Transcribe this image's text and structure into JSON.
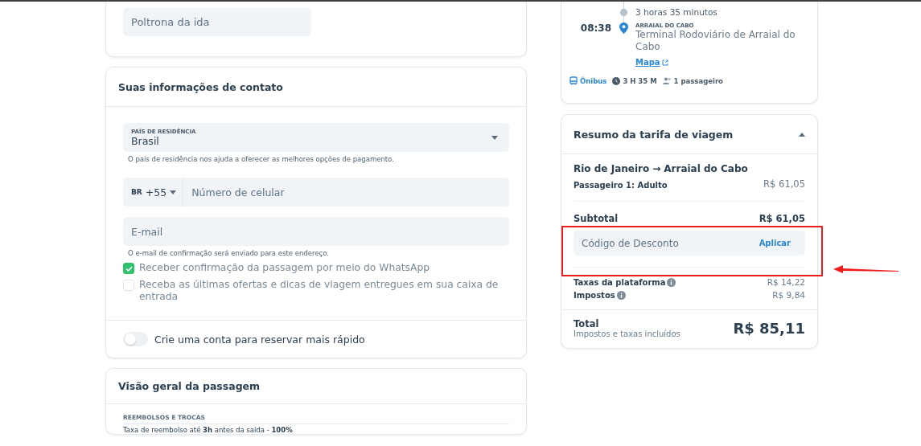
{
  "seat_card": {
    "seat_field": {
      "placeholder": "Poltrona da ida"
    }
  },
  "contact": {
    "title": "Suas informações de contato",
    "country": {
      "label": "PAÍS DE RESIDÊNCIA",
      "value": "Brasil",
      "hint": "O país de residência nos ajuda a oferecer as melhores opções de pagamento."
    },
    "phone": {
      "country_code": "BR",
      "dial": "+55",
      "placeholder": "Número de celular"
    },
    "email": {
      "placeholder": "E-mail",
      "hint": "O e-mail de confirmação será enviado para este endereço."
    },
    "checkboxes": [
      {
        "label": "Receber confirmação da passagem por meio do WhatsApp",
        "checked": true
      },
      {
        "label": "Receba as últimas ofertas e dicas de viagem entregues em sua caixa de entrada",
        "checked": false
      }
    ],
    "account_toggle": {
      "label": "Crie uma conta para reservar mais rápido",
      "on": false
    }
  },
  "overview": {
    "title": "Visão geral da passagem",
    "section": "REEMBOLSOS E TROCAS",
    "line": "Taxa de reembolso até **3h** antes da saída - **100%**"
  },
  "trip": {
    "duration": "3 horas 35 minutos",
    "arrival_time": "08:38",
    "arrival_city": "ARRAIAL DO CABO",
    "arrival_station": "Terminal Rodoviário de Arraial do Cabo",
    "map_link": "Mapa",
    "meta": [
      {
        "kind": "bus",
        "text": "Ônibus"
      },
      {
        "kind": "time",
        "text": "3 H 35 M"
      },
      {
        "kind": "people",
        "text": "1 passageiro"
      }
    ]
  },
  "fare": {
    "title": "Resumo da tarifa de viagem",
    "expanded": true,
    "route_from": "Rio de Janeiro",
    "route_arrow": "→",
    "route_to": "Arraial do Cabo",
    "passenger": {
      "label": "Passageiro 1: Adulto",
      "value": "R$ 61,05"
    },
    "subtotal": {
      "label": "Subtotal",
      "value": "R$ 61,05"
    },
    "discount": {
      "placeholder": "Código de Desconto",
      "button": "Aplicar"
    },
    "fees": [
      {
        "label": "Taxas da plataforma",
        "value": "R$ 14,22"
      },
      {
        "label": "Impostos",
        "value": "R$ 9,84"
      }
    ],
    "total": {
      "label": "Total",
      "note": "Impostos e taxas incluídos",
      "value": "R$ 85,11"
    }
  }
}
